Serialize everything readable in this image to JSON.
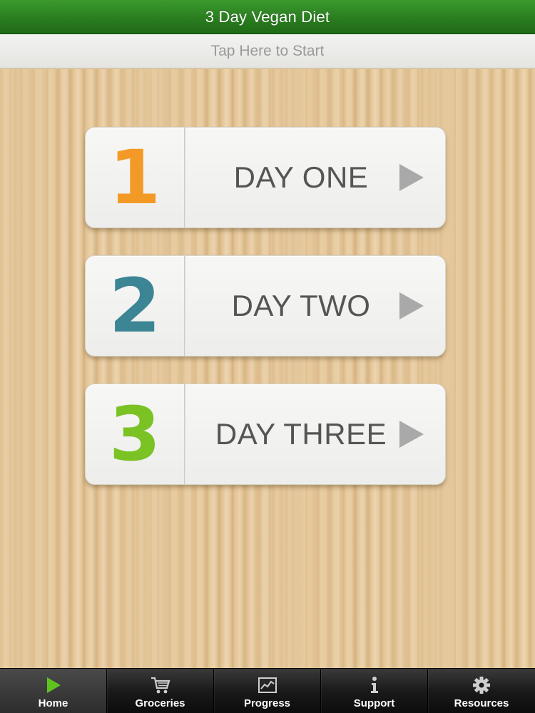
{
  "header": {
    "title": "3 Day Vegan Diet",
    "start_label": "Tap Here to Start"
  },
  "days": [
    {
      "number": "1",
      "label": "DAY ONE",
      "number_color": "#f39a26"
    },
    {
      "number": "2",
      "label": "DAY TWO",
      "number_color": "#3b8594"
    },
    {
      "number": "3",
      "label": "DAY THREE",
      "number_color": "#7bc225"
    }
  ],
  "tabbar": {
    "active": "Home",
    "tabs": [
      {
        "label": "Home",
        "icon": "play-icon"
      },
      {
        "label": "Groceries",
        "icon": "cart-icon"
      },
      {
        "label": "Progress",
        "icon": "chart-icon"
      },
      {
        "label": "Support",
        "icon": "info-icon"
      },
      {
        "label": "Resources",
        "icon": "gear-icon"
      }
    ]
  },
  "colors": {
    "header_green": "#2a7d1f",
    "active_tab_icon": "#5fc21f",
    "tab_icon": "#cfcfcf"
  }
}
